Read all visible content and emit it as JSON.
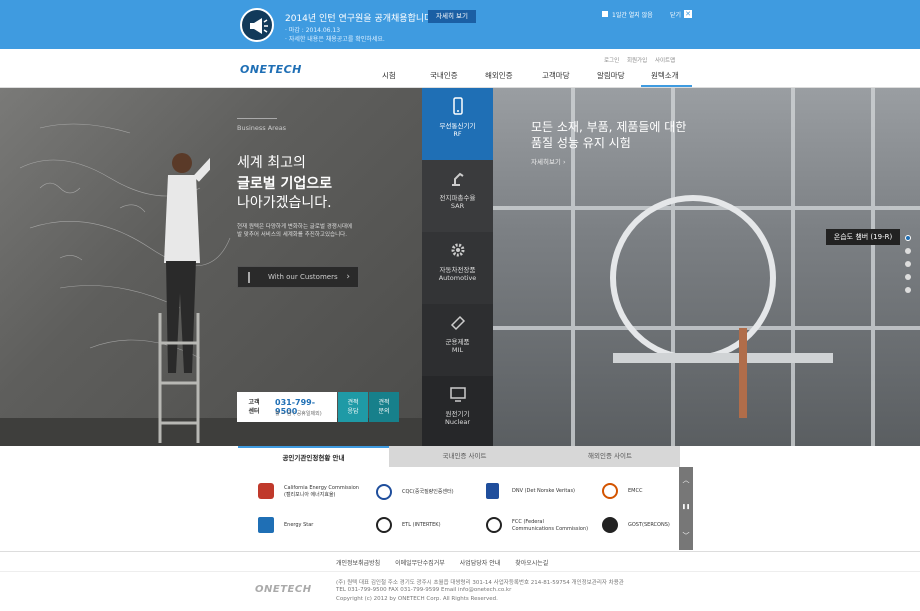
{
  "notice": {
    "title": "2014년 인턴 연구원을 공개채용합니다.",
    "line1": "·  마감 : 2014.06.13",
    "line2": "·  자세한 내용은 채용공고를 확인하세요.",
    "detail_button": "자세히 보기",
    "dont_open_label": "1일간 열지 않음",
    "close_label": "닫기",
    "close_symbol": "✕"
  },
  "header": {
    "logo": "ONETECH",
    "util_links": [
      "로그인",
      "회원가입",
      "사이트맵"
    ],
    "nav": [
      "시험",
      "국내인증",
      "해외인증",
      "고객마당",
      "알림마당",
      "원텍소개"
    ],
    "active_nav": "원텍소개"
  },
  "hero": {
    "section_label": "Business Areas",
    "headline_1": "세계 최고의",
    "headline_2": "글로벌 기업으로",
    "headline_3": "나아가겠습니다.",
    "desc_1": "현재 원텍은 다양하게 변화하는 글로벌 경쟁시대에",
    "desc_2": "발 맞추어 서비스의 세계화를 추진하고있습니다.",
    "customers_button": "With our Customers",
    "customers_arrow": "›",
    "call_center_label": "고객\n센터",
    "call_center_phone": "031-799-9500",
    "call_center_hours": "월 ~ 금 ( 공휴일제외)",
    "consult_button": "견적\n응답",
    "quote_button": "견적\n문의",
    "slide_title_1": "모든 소재, 부품, 제품들에 대한",
    "slide_title_2": "품질 성능 유지 시험",
    "slide_more": "자세히보기  ›",
    "slide_tag": "온습도 챔버 (19-R)"
  },
  "pillar": [
    {
      "ko": "무선통신기기",
      "en": "RF",
      "icon": "mobile-icon"
    },
    {
      "ko": "전지파총수율",
      "en": "SAR",
      "icon": "robot-arm-icon"
    },
    {
      "ko": "자동차전장품",
      "en": "Automotive",
      "icon": "gear-icon"
    },
    {
      "ko": "군용제품",
      "en": "MIL",
      "icon": "military-icon"
    },
    {
      "ko": "원전기기",
      "en": "Nuclear",
      "icon": "monitor-icon"
    }
  ],
  "tabs": [
    "공인기관인정현황 안내",
    "국내인증 사이트",
    "해외인증 사이트"
  ],
  "certs": [
    {
      "name": "California Energy Commission\n(캘리포니아 에너지효율)",
      "color": "#c0392b"
    },
    {
      "name": "CQC(중국질량인증센터)",
      "color": "#1f4e9c"
    },
    {
      "name": "DNV (Det Norske Veritas)",
      "color": "#1f4e9c"
    },
    {
      "name": "EMCC",
      "color": "#d35400"
    },
    {
      "name": "Energy Star",
      "color": "#1f6fb5"
    },
    {
      "name": "ETL (INTERTEK)",
      "color": "#222222"
    },
    {
      "name": "FCC (Federal\nCommunications Commission)",
      "color": "#222222"
    },
    {
      "name": "GOST(SERCONS)",
      "color": "#222222"
    }
  ],
  "side_controls": [
    "︿",
    "❚❚",
    "﹀"
  ],
  "footer": {
    "links": [
      "개인정보취급방침",
      "이메일무단수집거부",
      "사업담당자 안내",
      "찾아오시는길"
    ],
    "logo": "ONETECH",
    "line1": "(주) 원텍     대표 김인철       주소 경기도 광주시 초월읍 대쌍령리 301-14     사업자등록번호 214-81-59754      개인정보관리자 차용관",
    "line2": "TEL 031-799-9500      FAX 031-799-9599      Email info@onetech.co.kr",
    "line3": "Copyright (c) 2012 by ONETECH Corp. All Rights Reserved."
  },
  "colors": {
    "accent": "#3f9be0",
    "brand": "#1f6fb5",
    "teal": "#1f9aa6"
  }
}
